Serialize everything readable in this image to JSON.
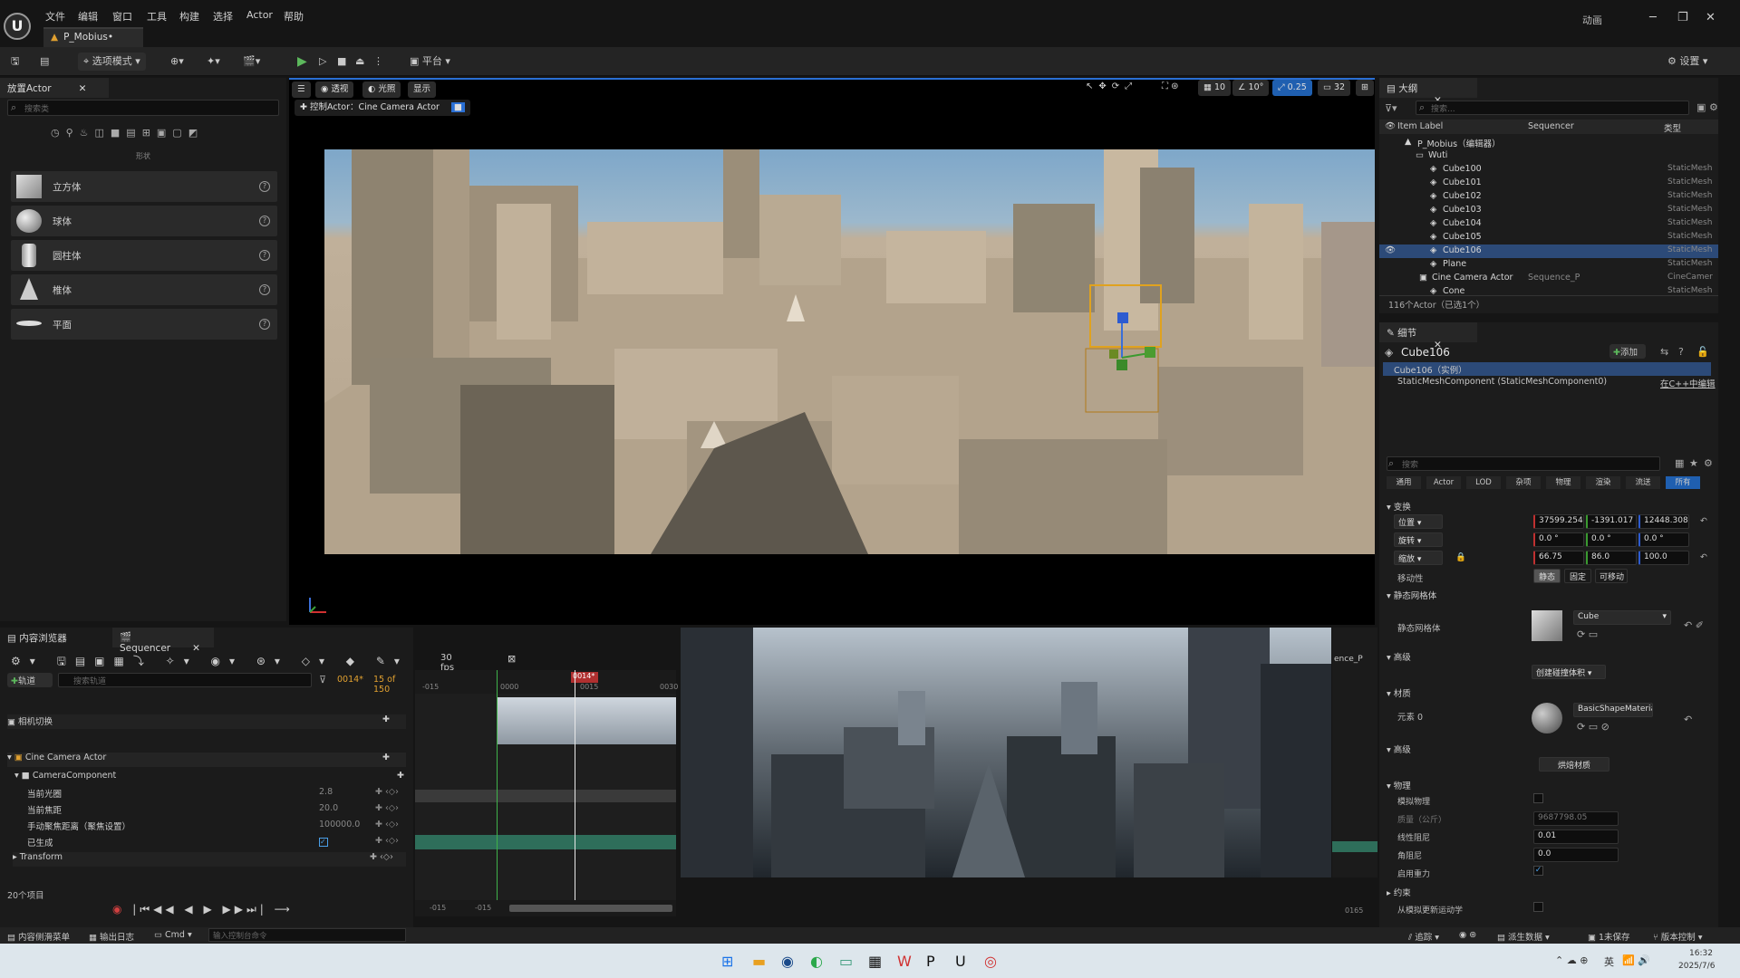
{
  "menu": [
    "文件",
    "编辑",
    "窗口",
    "工具",
    "构建",
    "选择",
    "Actor",
    "帮助"
  ],
  "doc_tab": "P_Mobius•",
  "anim_label": "动画",
  "toolbar": {
    "mode": "选项模式",
    "platform": "平台",
    "settings": "设置"
  },
  "place_actor": {
    "tab": "放置Actor",
    "search_placeholder": "搜索类",
    "category": "形状",
    "shapes": [
      "立方体",
      "球体",
      "圆柱体",
      "椎体",
      "平面"
    ]
  },
  "viewport": {
    "perspective": "透视",
    "lit": "光照",
    "show": "显示",
    "pilot": "控制Actor：Cine Camera Actor",
    "grid": "10",
    "angle": "10°",
    "scale": "0.25",
    "camera_speed": "32"
  },
  "outliner": {
    "tab": "大纲",
    "search_placeholder": "搜索...",
    "col_label": "Item Label",
    "col_seq": "Sequencer",
    "col_type": "类型",
    "items": [
      {
        "label": "P_Mobius（编辑器）",
        "type": ""
      },
      {
        "label": "Wuti",
        "type": ""
      },
      {
        "label": "Cube100",
        "type": "StaticMesh"
      },
      {
        "label": "Cube101",
        "type": "StaticMesh"
      },
      {
        "label": "Cube102",
        "type": "StaticMesh"
      },
      {
        "label": "Cube103",
        "type": "StaticMesh"
      },
      {
        "label": "Cube104",
        "type": "StaticMesh"
      },
      {
        "label": "Cube105",
        "type": "StaticMesh"
      },
      {
        "label": "Cube106",
        "type": "StaticMesh"
      },
      {
        "label": "Plane",
        "type": "StaticMesh"
      },
      {
        "label": "Cine Camera Actor",
        "seq": "Sequence_P",
        "type": "CineCamer"
      },
      {
        "label": "Cone",
        "type": "StaticMesh"
      }
    ],
    "count": "116个Actor（已选1个）"
  },
  "details": {
    "tab": "细节",
    "title": "Cube106",
    "add": "添加",
    "instance": "Cube106（实例）",
    "component": "StaticMeshComponent (StaticMeshComponent0)",
    "edit_cpp": "在C++中编辑",
    "search_placeholder": "搜索",
    "filters": [
      "通用",
      "Actor",
      "LOD",
      "杂项",
      "物理",
      "渲染",
      "流送",
      "所有"
    ],
    "transform_section": "变换",
    "location_label": "位置",
    "location": [
      "37599.254",
      "-1391.017",
      "12448.308"
    ],
    "rotation_label": "旋转",
    "rotation": [
      "0.0 °",
      "0.0 °",
      "0.0 °"
    ],
    "scale_label": "缩放",
    "scale": [
      "66.75",
      "86.0",
      "100.0"
    ],
    "mobility_label": "移动性",
    "mobility": [
      "静态",
      "固定",
      "可移动"
    ],
    "static_mesh_section": "静态网格体",
    "static_mesh_label": "静态网格体",
    "static_mesh": "Cube",
    "advanced_section": "高级",
    "create_physics": "创建碰撞体积",
    "materials_section": "材质",
    "element0": "元素 0",
    "material": "BasicShapeMaterial",
    "advanced2_section": "高级",
    "bake": "烘焙材质",
    "physics_section": "物理",
    "simulate": "模拟物理",
    "mass": "质量（公斤）",
    "mass_value": "9687798.05",
    "linear_damping": "线性阻尼",
    "linear_value": "0.01",
    "angular_damping": "角阻尼",
    "angular_value": "0.0",
    "gravity": "启用重力",
    "constraints_section": "约束",
    "kinematic": "从模拟更新运动学"
  },
  "content_browser_tab": "内容浏览器",
  "sequencer": {
    "tab": "Sequencer",
    "add_track": "轨道",
    "search_placeholder": "搜索轨道",
    "fps": "30 fps",
    "frame": "0014*",
    "of": "15 of 150",
    "camera_cuts": "相机切换",
    "cine_actor": "Cine Camera Actor",
    "camera_component": "CameraComponent",
    "props": [
      {
        "name": "当前光圈",
        "val": "2.8"
      },
      {
        "name": "当前焦距",
        "val": "20.0"
      },
      {
        "name": "手动聚焦距离（聚焦设置）",
        "val": "100000.0"
      },
      {
        "name": "已生成",
        "val": ""
      }
    ],
    "transform": "Transform",
    "items_count": "20个项目",
    "playhead": "0014*",
    "t_start": "-015",
    "t_start2": "-015",
    "t_end": "0165",
    "r_label": "-015",
    "r0": "0000",
    "r1": "0015",
    "r2": "0030",
    "seq_name": "ence_P"
  },
  "status": {
    "drawer": "内容侧滑菜单",
    "output": "输出日志",
    "cmd": "Cmd",
    "console_placeholder": "输入控制台命令",
    "trace": "追踪",
    "derived": "派生数据",
    "unsaved": "1未保存",
    "source": "版本控制"
  },
  "taskbar": {
    "time": "16:32",
    "date": "2025/7/6",
    "lang": "英"
  }
}
